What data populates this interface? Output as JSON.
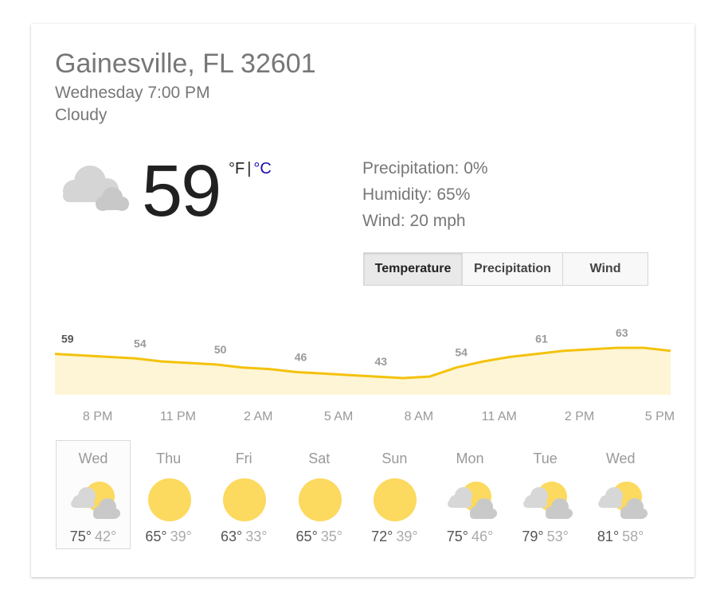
{
  "location": "Gainesville, FL 32601",
  "datetime": "Wednesday 7:00 PM",
  "condition": "Cloudy",
  "current": {
    "icon": "cloudy-icon",
    "temperature": "59",
    "unit_f": "°F",
    "unit_sep": "|",
    "unit_c": "°C"
  },
  "details": {
    "precipitation": "Precipitation: 0%",
    "humidity": "Humidity: 65%",
    "wind": "Wind: 20 mph"
  },
  "tabs": [
    {
      "label": "Temperature",
      "active": true
    },
    {
      "label": "Precipitation",
      "active": false
    },
    {
      "label": "Wind",
      "active": false
    }
  ],
  "chart_data": {
    "type": "area",
    "x": [
      "7 PM",
      "8 PM",
      "9 PM",
      "10 PM",
      "11 PM",
      "12 AM",
      "1 AM",
      "2 AM",
      "3 AM",
      "4 AM",
      "5 AM",
      "6 AM",
      "7 AM",
      "8 AM",
      "9 AM",
      "10 AM",
      "11 AM",
      "12 PM",
      "1 PM",
      "2 PM",
      "3 PM",
      "4 PM",
      "5 PM",
      "6 PM"
    ],
    "values": [
      59,
      58,
      57,
      56,
      54,
      53,
      52,
      50,
      49,
      47,
      46,
      45,
      44,
      43,
      44,
      50,
      54,
      57,
      59,
      61,
      62,
      63,
      63,
      61
    ],
    "labels": [
      {
        "x": "7 PM",
        "text": "59"
      },
      {
        "x": "10 PM",
        "text": "54"
      },
      {
        "x": "1 AM",
        "text": "50"
      },
      {
        "x": "4 AM",
        "text": "46"
      },
      {
        "x": "7 AM",
        "text": "43"
      },
      {
        "x": "10 AM",
        "text": "54"
      },
      {
        "x": "1 PM",
        "text": "61"
      },
      {
        "x": "4 PM",
        "text": "63"
      }
    ],
    "tick_labels": [
      "8 PM",
      "11 PM",
      "2 AM",
      "5 AM",
      "8 AM",
      "11 AM",
      "2 PM",
      "5 PM"
    ],
    "line_color": "#f4c20d",
    "fill_color": "#fdf5d5"
  },
  "days": [
    {
      "name": "Wed",
      "icon": "partly-cloudy-icon",
      "hi": "75°",
      "lo": "42°",
      "selected": true
    },
    {
      "name": "Thu",
      "icon": "sunny-icon",
      "hi": "65°",
      "lo": "39°",
      "selected": false
    },
    {
      "name": "Fri",
      "icon": "sunny-icon",
      "hi": "63°",
      "lo": "33°",
      "selected": false
    },
    {
      "name": "Sat",
      "icon": "sunny-icon",
      "hi": "65°",
      "lo": "35°",
      "selected": false
    },
    {
      "name": "Sun",
      "icon": "sunny-icon",
      "hi": "72°",
      "lo": "39°",
      "selected": false
    },
    {
      "name": "Mon",
      "icon": "partly-cloudy-icon",
      "hi": "75°",
      "lo": "46°",
      "selected": false
    },
    {
      "name": "Tue",
      "icon": "partly-cloudy-icon",
      "hi": "79°",
      "lo": "53°",
      "selected": false
    },
    {
      "name": "Wed",
      "icon": "partly-cloudy-icon",
      "hi": "81°",
      "lo": "58°",
      "selected": false
    }
  ]
}
